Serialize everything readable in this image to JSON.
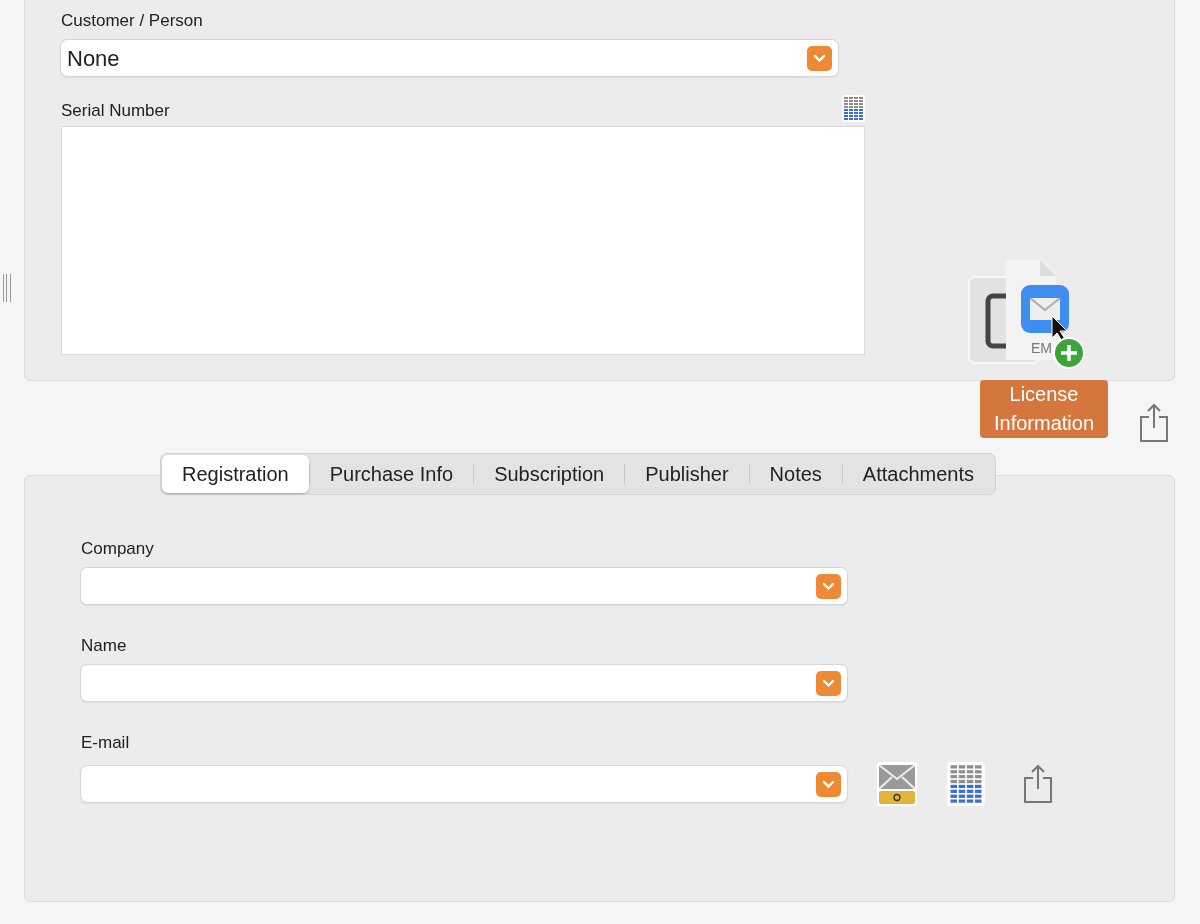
{
  "customer": {
    "label": "Customer / Person",
    "value": "None"
  },
  "serial": {
    "label": "Serial Number"
  },
  "drag": {
    "file_label": "EM",
    "label": "License Information"
  },
  "tabs": [
    {
      "label": "Registration",
      "selected": true
    },
    {
      "label": "Purchase Info",
      "selected": false
    },
    {
      "label": "Subscription",
      "selected": false
    },
    {
      "label": "Publisher",
      "selected": false
    },
    {
      "label": "Notes",
      "selected": false
    },
    {
      "label": "Attachments",
      "selected": false
    }
  ],
  "fields": [
    {
      "label": "Company",
      "kind": "plain"
    },
    {
      "label": "Name",
      "kind": "plain"
    },
    {
      "label": "E-mail",
      "kind": "email"
    }
  ]
}
